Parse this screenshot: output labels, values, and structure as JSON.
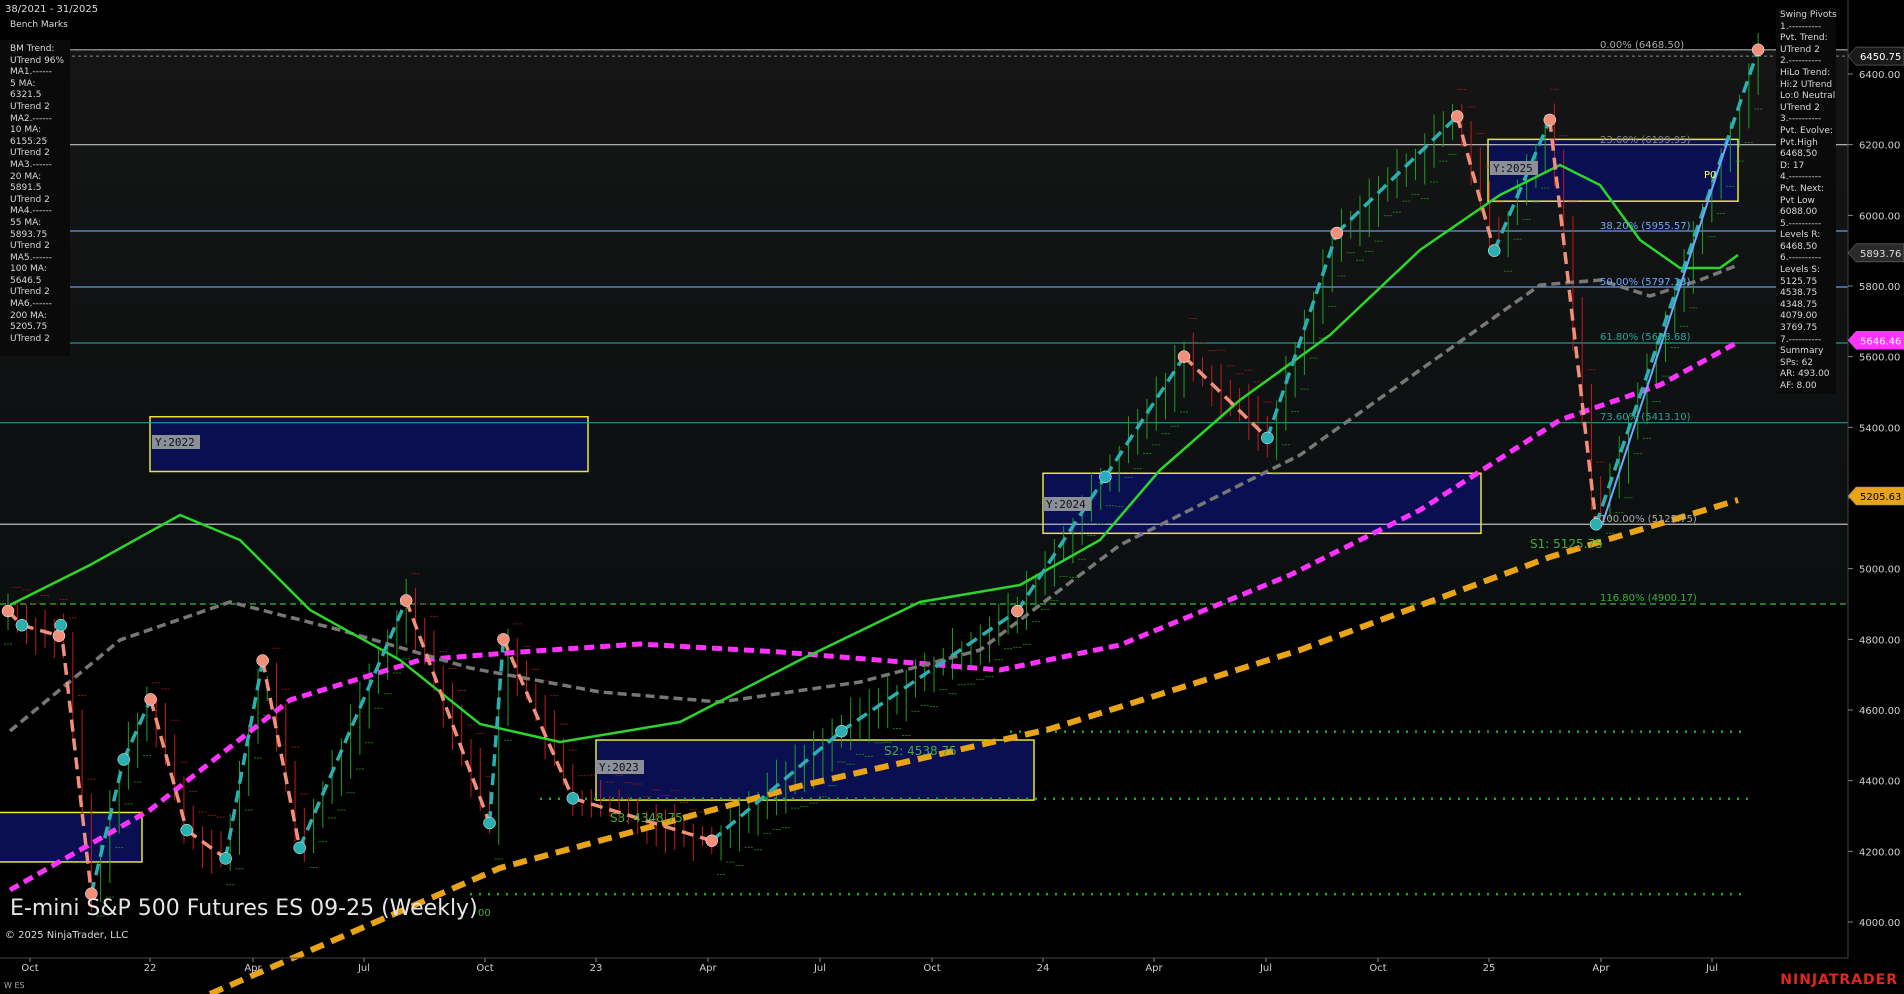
{
  "window": {
    "title": "E-mini S&P 500 Futures ES 09-25 (Weekly)",
    "copyright": "© 2025 NinjaTrader, LLC",
    "date_range": "38/2021 - 31/2025",
    "bench_marks_label": "Bench Marks",
    "brand": "NINJATRADER",
    "instrument_short": "W ES"
  },
  "left_panel": {
    "lines": [
      "BM Trend:",
      "UTrend 96%",
      "MA1.------",
      "5 MA:",
      "6321.5",
      "UTrend 2",
      "MA2.------",
      "10 MA:",
      "6155.25",
      "UTrend 2",
      "MA3.------",
      "20 MA:",
      "5891.5",
      "UTrend 2",
      "MA4.------",
      "55 MA:",
      "5893.75",
      "UTrend 2",
      "MA5.------",
      "100 MA:",
      "5646.5",
      "UTrend 2",
      "MA6.------",
      "200 MA:",
      "5205.75",
      "UTrend 2"
    ]
  },
  "right_panel": {
    "lines": [
      "Swing Pivots",
      "1.----------",
      "Pvt. Trend:",
      "UTrend 2",
      "2.----------",
      "HiLo Trend:",
      "Hi:2 UTrend",
      "Lo:0 Neutral",
      "UTrend 2",
      "3.----------",
      "Pvt. Evolve:",
      "Pvt.High",
      "6468.50",
      "D: 17",
      "4.----------",
      "Pvt. Next:",
      "Pvt Low",
      "6088.00",
      "5.----------",
      "Levels R:",
      "6468.50",
      "6.----------",
      "Levels S:",
      "5125.75",
      "4538.75",
      "4348.75",
      "4079.00",
      "3769.75",
      "7.----------",
      "Summary",
      "SPs: 62",
      "AR: 493.00",
      "AF: 8.00"
    ]
  },
  "price_tags": [
    {
      "label": "6450.75",
      "value": 6450.75,
      "bg": "#1a1a1a",
      "fg": "#ffffff"
    },
    {
      "label": "5893.76",
      "value": 5893.76,
      "bg": "#2a2a2a",
      "fg": "#dddddd"
    },
    {
      "label": "5646.46",
      "value": 5646.46,
      "bg": "#ff33ff",
      "fg": "#ffffff"
    },
    {
      "label": "5205.63",
      "value": 5205.63,
      "bg": "#e8a317",
      "fg": "#000000"
    }
  ],
  "box_labels": [
    "Y:2022",
    "Y:2023",
    "Y:2024",
    "Y:2025"
  ],
  "level_labels": [
    {
      "text": "0.00% (6468.50)",
      "value": 6468.5,
      "color": "#aaaaaa"
    },
    {
      "text": "23.60% (6199.95)",
      "value": 6199.95,
      "color": "#888888"
    },
    {
      "text": "38.20% (5955.57)",
      "value": 5955.57,
      "color": "#6fa8ff"
    },
    {
      "text": "50.00% (5797.13)",
      "value": 5797.13,
      "color": "#6fa8ff"
    },
    {
      "text": "61.80% (5638.68)",
      "value": 5638.68,
      "color": "#26a69a"
    },
    {
      "text": "73.60% (5413.10)",
      "value": 5413.1,
      "color": "#26a69a"
    },
    {
      "text": "100.00% (5125.75)",
      "value": 5125.75,
      "color": "#aaaaaa"
    },
    {
      "text": "116.80% (4900.17)",
      "value": 4900.17,
      "color": "#3fae3f"
    },
    {
      "text": "S1: 5125.75",
      "value": 5125.75,
      "color": "#3fae3f"
    },
    {
      "text": "S2: 4538.75",
      "value": 4538.75,
      "color": "#3fae3f"
    },
    {
      "text": "S3: 4348.75",
      "value": 4348.75,
      "color": "#3fae3f"
    },
    {
      "text": "P0",
      "value": 6130,
      "color": "#ffff66"
    },
    {
      "text": "00",
      "value": 4072,
      "color": "#3fae3f"
    }
  ],
  "chart_data": {
    "type": "line",
    "title": "E-mini S&P 500 Futures ES 09-25 (Weekly)",
    "x_axis_labels": [
      "Oct",
      "22",
      "Apr",
      "Jul",
      "Oct",
      "23",
      "Apr",
      "Jul",
      "Oct",
      "24",
      "Apr",
      "Jul",
      "Oct",
      "25",
      "Apr",
      "Jul"
    ],
    "y_ticks": [
      4000,
      4200,
      4400,
      4600,
      4800,
      5000,
      5200,
      5400,
      5600,
      5800,
      6000,
      6200,
      6400
    ],
    "ylim": [
      3900,
      6590
    ],
    "horizontal_levels": [
      6468.5,
      6199.95,
      5955.57,
      5797.13,
      5638.68,
      5413.1,
      5125.75,
      4900.17
    ],
    "support_levels": [
      4538.75,
      4348.75,
      4079.0
    ],
    "swing_pivots": [
      {
        "t": 0.0,
        "v": 4880,
        "type": "high"
      },
      {
        "t": 1.5,
        "v": 4840,
        "type": "low"
      },
      {
        "t": 5.5,
        "v": 4810,
        "type": "high"
      },
      {
        "t": 5.7,
        "v": 4840,
        "type": "low"
      },
      {
        "t": 9.0,
        "v": 4080,
        "type": "high"
      },
      {
        "t": 12.5,
        "v": 4460,
        "type": "low"
      },
      {
        "t": 15.4,
        "v": 4630,
        "type": "high"
      },
      {
        "t": 19.3,
        "v": 4260,
        "type": "low"
      },
      {
        "t": 23.5,
        "v": 4180,
        "type": "low"
      },
      {
        "t": 27.5,
        "v": 4740,
        "type": "high"
      },
      {
        "t": 31.5,
        "v": 4210,
        "type": "low"
      },
      {
        "t": 43.0,
        "v": 4910,
        "type": "high"
      },
      {
        "t": 52.0,
        "v": 4280,
        "type": "low"
      },
      {
        "t": 53.5,
        "v": 4800,
        "type": "high"
      },
      {
        "t": 61.0,
        "v": 4350,
        "type": "low"
      },
      {
        "t": 76.0,
        "v": 4230,
        "type": "high"
      },
      {
        "t": 90.0,
        "v": 4540,
        "type": "low"
      },
      {
        "t": 109.0,
        "v": 4880,
        "type": "high"
      },
      {
        "t": 118.5,
        "v": 5260,
        "type": "low"
      },
      {
        "t": 127.0,
        "v": 5600,
        "type": "high"
      },
      {
        "t": 136.0,
        "v": 5370,
        "type": "low"
      },
      {
        "t": 143.5,
        "v": 5950,
        "type": "high"
      },
      {
        "t": 156.5,
        "v": 6280,
        "type": "high"
      },
      {
        "t": 160.5,
        "v": 5900,
        "type": "low"
      },
      {
        "t": 166.5,
        "v": 6270,
        "type": "high"
      },
      {
        "t": 171.5,
        "v": 5125.75,
        "type": "low"
      },
      {
        "t": 189.0,
        "v": 6468.5,
        "type": "high"
      }
    ],
    "series": [
      {
        "name": "5 MA",
        "value": 6321.5,
        "color": "#2bd52b"
      },
      {
        "name": "100 MA",
        "value": 5646.5,
        "color": "#ff33ff"
      },
      {
        "name": "200 MA",
        "value": 5205.75,
        "color": "#e8a317"
      },
      {
        "name": "55 MA",
        "value": 5893.75,
        "color": "#777777"
      }
    ],
    "grid": false,
    "legend": "none"
  }
}
